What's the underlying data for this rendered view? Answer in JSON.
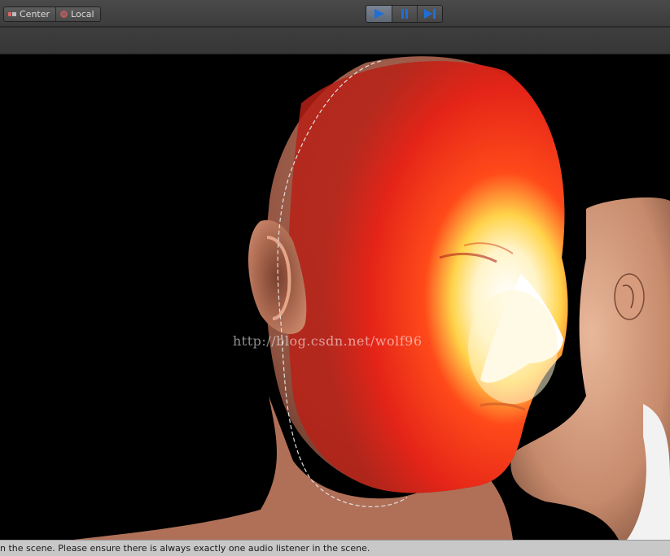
{
  "toolbar": {
    "pivot_position_label": "Center",
    "pivot_rotation_label": "Local",
    "play_icon": "play-icon",
    "pause_icon": "pause-icon",
    "step_icon": "step-icon",
    "accent_color": "#1e6fd8"
  },
  "viewport": {
    "watermark": "http://blog.csdn.net/wolf96"
  },
  "status": {
    "message": "n the scene. Please ensure there is always exactly one audio listener in the scene."
  }
}
